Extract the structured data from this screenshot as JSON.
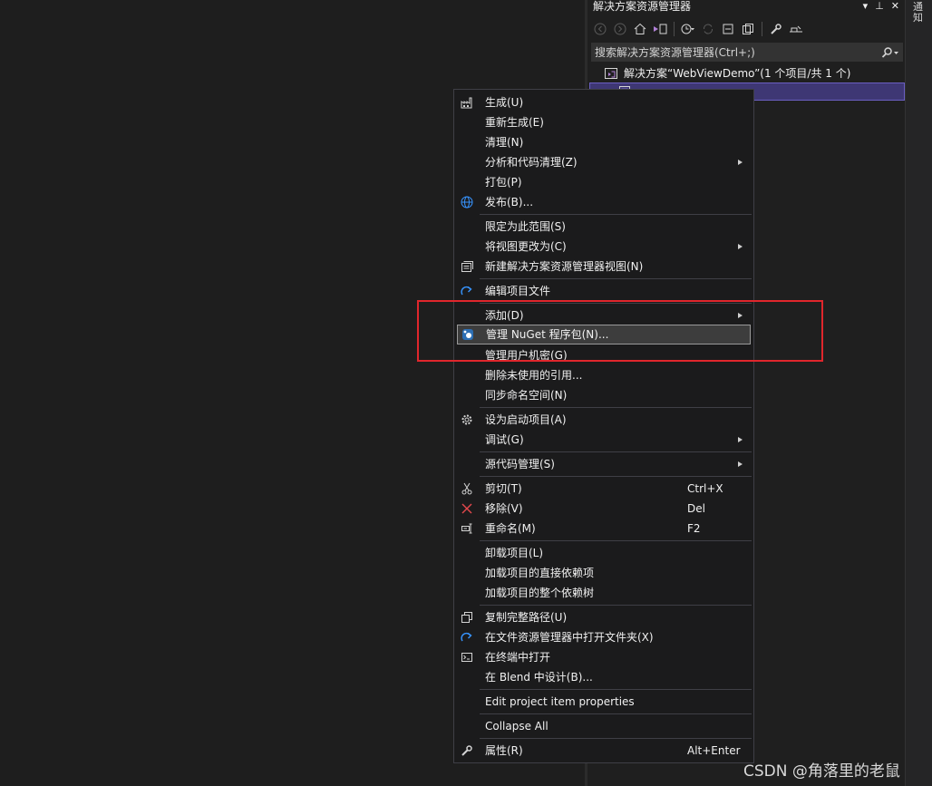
{
  "solution_explorer": {
    "title": "解决方案资源管理器",
    "title_tools": [
      "▾",
      "⊥",
      "✕"
    ],
    "search_placeholder": "搜索解决方案资源管理器(Ctrl+;)",
    "solution_label": "解决方案“WebViewDemo”(1 个项目/共 1 个)",
    "project_label": ""
  },
  "right_strip_label": "通知",
  "context_menu": {
    "build": "生成(U)",
    "rebuild": "重新生成(E)",
    "clean": "清理(N)",
    "analyze": "分析和代码清理(Z)",
    "pack": "打包(P)",
    "publish": "发布(B)...",
    "scope": "限定为此范围(S)",
    "change_view": "将视图更改为(C)",
    "new_view": "新建解决方案资源管理器视图(N)",
    "edit_project": "编辑项目文件",
    "add": "添加(D)",
    "nuget": "管理 NuGet 程序包(N)...",
    "user_secrets": "管理用户机密(G)",
    "remove_refs": "删除未使用的引用...",
    "sync_ns": "同步命名空间(N)",
    "startup": "设为启动项目(A)",
    "debug": "调试(G)",
    "source_control": "源代码管理(S)",
    "cut": "剪切(T)",
    "cut_shortcut": "Ctrl+X",
    "remove": "移除(V)",
    "remove_shortcut": "Del",
    "rename": "重命名(M)",
    "rename_shortcut": "F2",
    "unload": "卸载项目(L)",
    "load_direct": "加载项目的直接依赖项",
    "load_tree": "加载项目的整个依赖树",
    "copy_path": "复制完整路径(U)",
    "open_folder": "在文件资源管理器中打开文件夹(X)",
    "open_terminal": "在终端中打开",
    "blend": "在 Blend 中设计(B)...",
    "edit_props": "Edit project item properties",
    "collapse": "Collapse All",
    "properties": "属性(R)",
    "properties_shortcut": "Alt+Enter"
  },
  "colors": {
    "background": "#1e1e1e",
    "menu_background": "#1b1b1c",
    "highlight": "#3d3d3d",
    "selection": "#3e3774",
    "annotation_box": "#e0262c",
    "icon_blue": "#3794ff",
    "icon_red": "#e5484d"
  },
  "watermark": "CSDN @角落里的老鼠"
}
